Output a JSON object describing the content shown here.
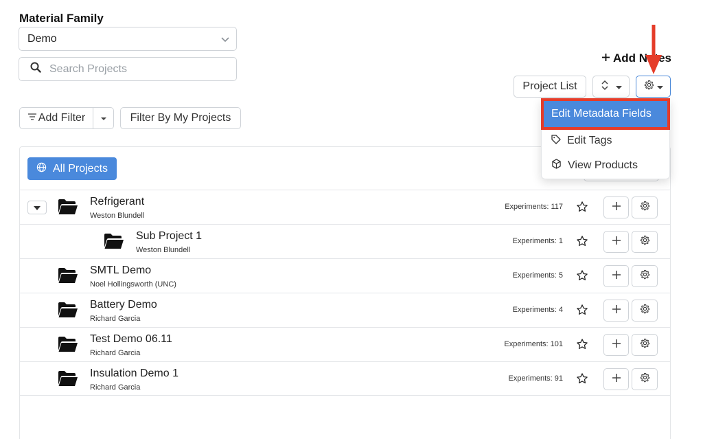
{
  "material_family": {
    "label": "Material Family",
    "selected": "Demo"
  },
  "search": {
    "placeholder": "Search Projects",
    "value": ""
  },
  "filters": {
    "add_filter_label": "Add Filter",
    "filter_mine_label": "Filter By My Projects"
  },
  "toolbar": {
    "add_notes_label": "Add Notes",
    "project_list_label": "Project List"
  },
  "settings_menu": {
    "items": [
      {
        "label": "Edit Metadata Fields",
        "icon": "none",
        "active": true
      },
      {
        "label": "Edit Tags",
        "icon": "tag-icon"
      },
      {
        "label": "View Products",
        "icon": "cube-icon"
      }
    ]
  },
  "all_projects_label": "All Projects",
  "projects": [
    {
      "name": "Refrigerant",
      "owner": "Weston Blundell",
      "experiments": "Experiments: 117",
      "level": 0,
      "expandable": true
    },
    {
      "name": "Sub Project 1",
      "owner": "Weston Blundell",
      "experiments": "Experiments: 1",
      "level": 1,
      "expandable": false
    },
    {
      "name": "SMTL Demo",
      "owner": "Noel Hollingsworth (UNC)",
      "experiments": "Experiments: 5",
      "level": 0,
      "expandable": false
    },
    {
      "name": "Battery Demo",
      "owner": "Richard Garcia",
      "experiments": "Experiments: 4",
      "level": 0,
      "expandable": false
    },
    {
      "name": "Test Demo 06.11",
      "owner": "Richard Garcia",
      "experiments": "Experiments: 101",
      "level": 0,
      "expandable": false
    },
    {
      "name": "Insulation Demo 1",
      "owner": "Richard Garcia",
      "experiments": "Experiments: 91",
      "level": 0,
      "expandable": false
    }
  ],
  "colors": {
    "accent": "#4a89dc",
    "highlight": "#e53c29",
    "border": "#cfd3d8"
  }
}
